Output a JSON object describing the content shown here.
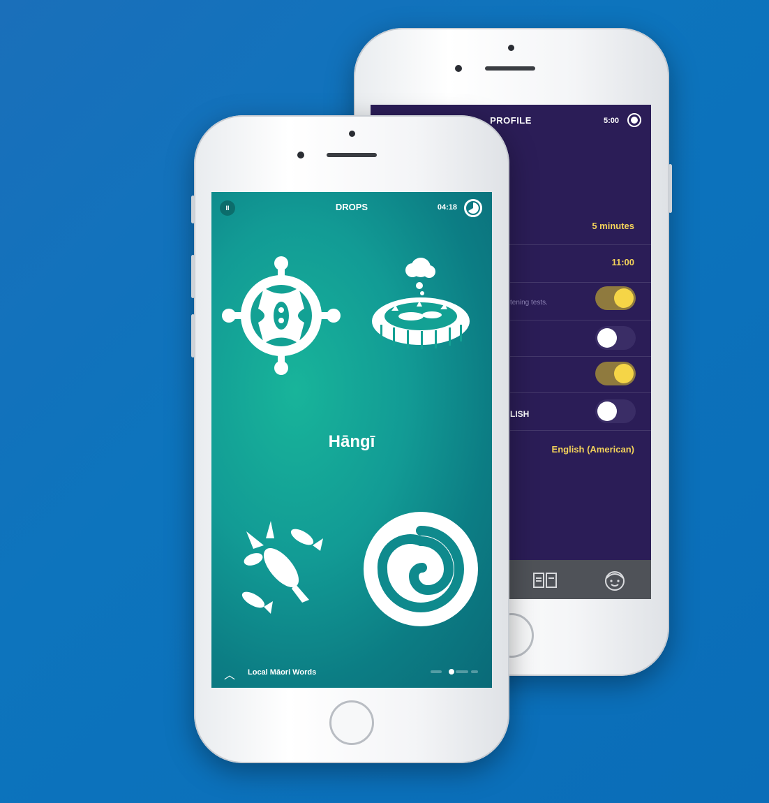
{
  "profile_screen": {
    "title": "PROFILE",
    "timer": "5:00",
    "rows": [
      {
        "value": "5 minutes"
      },
      {
        "value": "11:00"
      },
      {
        "sub": "tening tests."
      },
      {
        "label": "LISH"
      },
      {
        "value": "English (American)"
      }
    ],
    "toggles": [
      true,
      false,
      true,
      false
    ],
    "tabs": [
      "book-icon",
      "profile-face-icon"
    ]
  },
  "drops_screen": {
    "pause_label": "II",
    "title": "DROPS",
    "timer": "04:18",
    "word": "Hāngī",
    "category": "Local Māori Words",
    "icons": [
      "wheel-carving-icon",
      "hangi-pit-icon",
      "crayfish-fish-icon",
      "koru-spiral-icon"
    ]
  },
  "colors": {
    "background": "#0d74bd",
    "profile_bg": "#2b1d57",
    "accent_yellow": "#f3d25a",
    "drops_teal": "#129b95"
  }
}
